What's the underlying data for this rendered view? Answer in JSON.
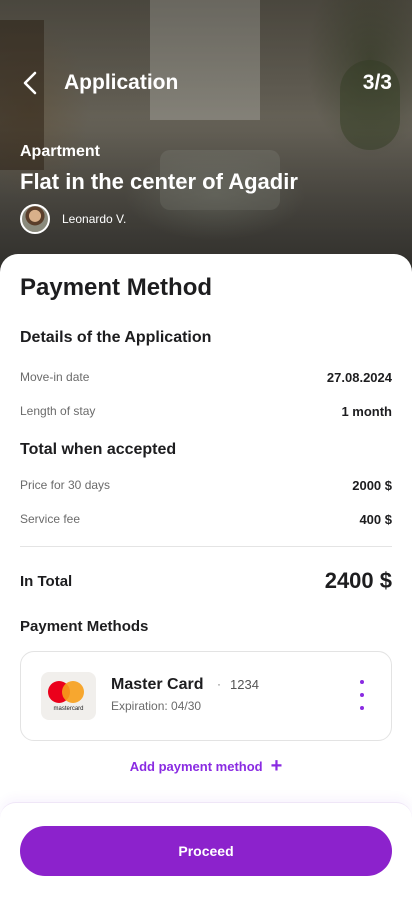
{
  "header": {
    "title": "Application",
    "step": "3/3",
    "category": "Apartment",
    "listing_title": "Flat in the center of Agadir",
    "host_name": "Leonardo V."
  },
  "payment": {
    "title": "Payment Method",
    "details": {
      "title": "Details of the Application",
      "rows": [
        {
          "label": "Move-in date",
          "value": "27.08.2024"
        },
        {
          "label": "Length of stay",
          "value": "1 month"
        }
      ]
    },
    "total": {
      "title": "Total when accepted",
      "rows": [
        {
          "label": "Price for 30 days",
          "value": "2000 $"
        },
        {
          "label": "Service fee",
          "value": "400 $"
        }
      ],
      "sum_label": "In Total",
      "sum_value": "2400 $"
    },
    "methods": {
      "title": "Payment Methods",
      "card": {
        "brand_text": "mastercard",
        "name": "Master Card",
        "separator": "·",
        "number": "1234",
        "expiration": "Expiration: 04/30"
      },
      "add_label": "Add payment method",
      "add_icon": "+"
    },
    "proceed_label": "Proceed"
  },
  "colors": {
    "accent": "#8c22cc",
    "link": "#8a2be2",
    "mastercard_red": "#eb001b",
    "mastercard_orange": "#f79e1b"
  },
  "icons": [
    "back-arrow-icon",
    "more-vertical-icon",
    "plus-icon",
    "mastercard-logo"
  ]
}
